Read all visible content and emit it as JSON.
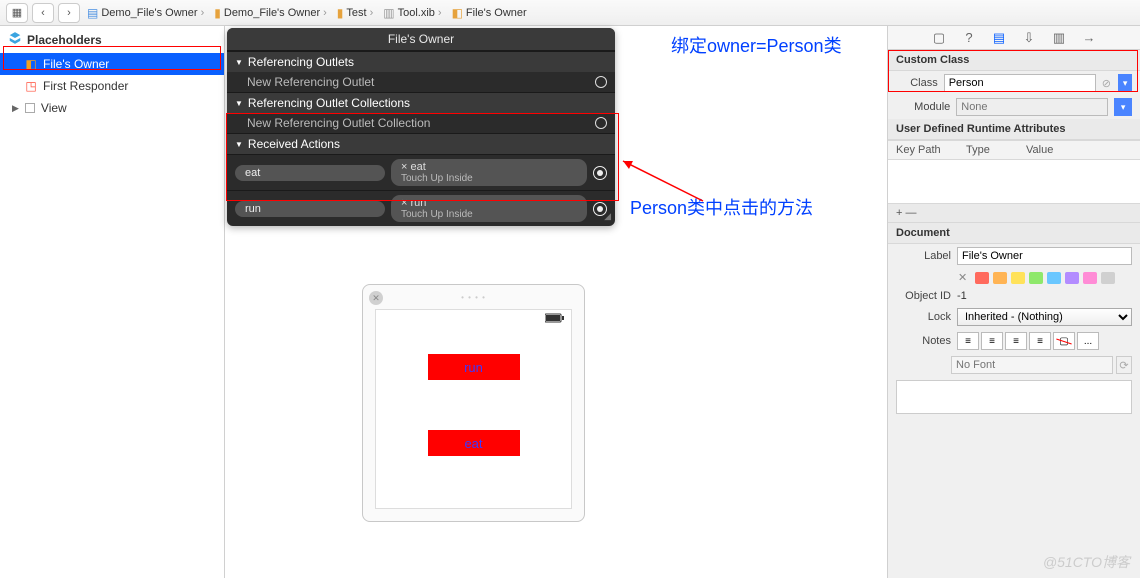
{
  "toolbar": {
    "back": "‹",
    "fwd": "›",
    "crumbs": [
      {
        "icon": "proj",
        "label": "Demo_File's Owner"
      },
      {
        "icon": "folder",
        "label": "Demo_File's Owner"
      },
      {
        "icon": "folder",
        "label": "Test"
      },
      {
        "icon": "xib",
        "label": "Tool.xib"
      },
      {
        "icon": "owner",
        "label": "File's Owner"
      }
    ]
  },
  "outline": {
    "header": "Placeholders",
    "items": [
      {
        "label": "File's Owner",
        "icon": "cube",
        "selected": true
      },
      {
        "label": "First Responder",
        "icon": "first",
        "selected": false
      }
    ],
    "view": "View"
  },
  "connections": {
    "title": "File's Owner",
    "sections": [
      {
        "name": "Referencing Outlets",
        "items": [
          {
            "label": "New Referencing Outlet"
          }
        ]
      },
      {
        "name": "Referencing Outlet Collections",
        "items": [
          {
            "label": "New Referencing Outlet Collection"
          }
        ]
      },
      {
        "name": "Received Actions",
        "actions": [
          {
            "name": "eat",
            "target": "eat",
            "event": "Touch Up Inside"
          },
          {
            "name": "run",
            "target": "run",
            "event": "Touch Up Inside"
          }
        ]
      }
    ]
  },
  "annotation": {
    "bind_owner": "绑定owner=Person类",
    "methods": "Person类中点击的方法"
  },
  "device": {
    "buttons": [
      {
        "label": "run"
      },
      {
        "label": "eat"
      }
    ]
  },
  "inspector": {
    "custom_class_section": "Custom Class",
    "class_label": "Class",
    "class_value": "Person",
    "module_label": "Module",
    "module_value": "None",
    "runtime_section": "User Defined Runtime Attributes",
    "cols": [
      "Key Path",
      "Type",
      "Value"
    ],
    "plusminus": "+  —",
    "doc_section": "Document",
    "label_label": "Label",
    "label_value": "File's Owner",
    "colors": [
      "#ff6a5d",
      "#ffb454",
      "#ffe25a",
      "#8ee86b",
      "#6ac7ff",
      "#b38cff",
      "#ff8cd6",
      "#d0d0d0"
    ],
    "objid_label": "Object ID",
    "objid_value": "-1",
    "lock_label": "Lock",
    "lock_value": "Inherited - (Nothing)",
    "notes_label": "Notes",
    "nofont": "No Font",
    "seg_more": "..."
  },
  "watermark": "@51CTO博客"
}
